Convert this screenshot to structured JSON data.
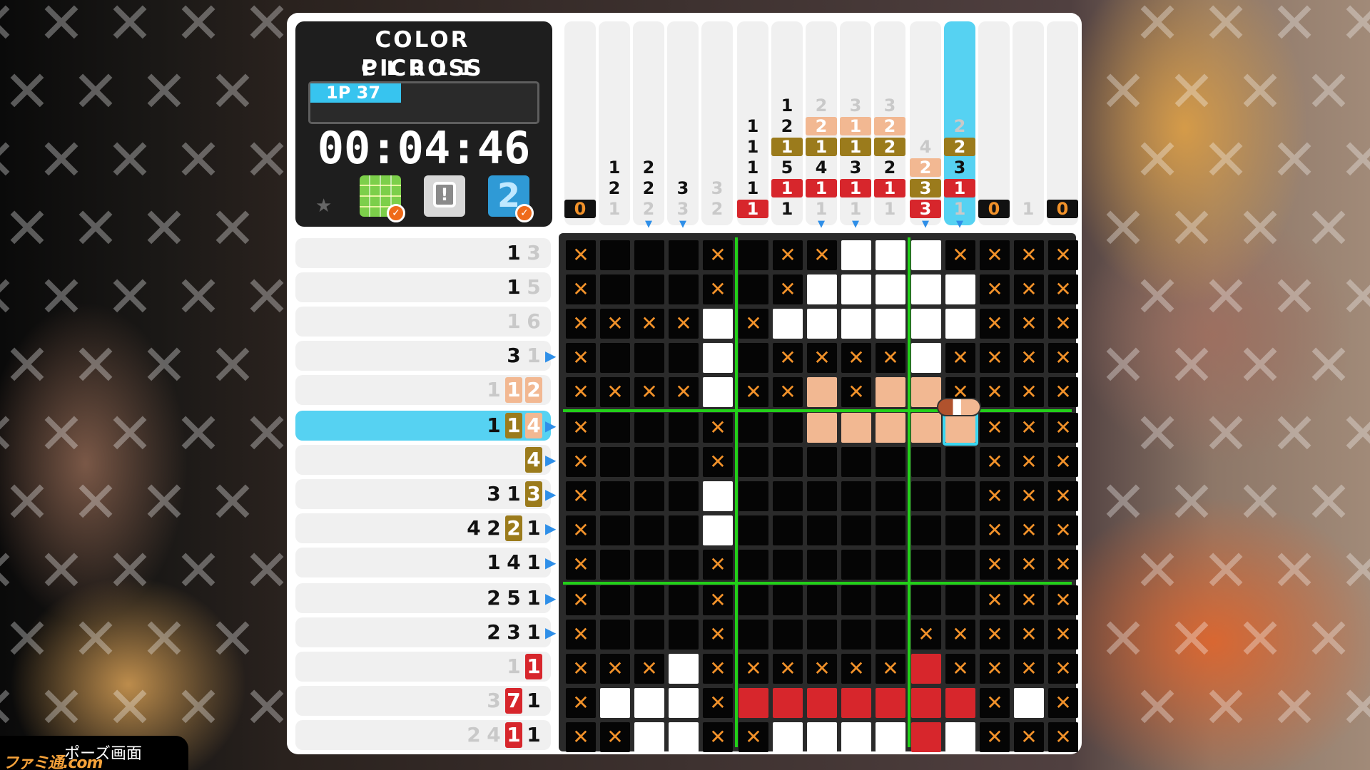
{
  "game": {
    "title": "COLOR PICROSS",
    "puzzle_code": "CL011",
    "player_label": "1P  37",
    "progress_fraction": 0.4,
    "timer": "00:04:46",
    "hints": [
      {
        "icon": "grid-hint-icon",
        "glyph": "",
        "used": true
      },
      {
        "icon": "exclamation-hint-icon",
        "glyph": "!",
        "used": false
      },
      {
        "icon": "number-2-hint-icon",
        "glyph": "2",
        "used": true
      }
    ],
    "footer_label": "ポーズ画面",
    "watermark": "ファミ通.com"
  },
  "colors": {
    "black": "#050505",
    "white": "#ffffff",
    "peach": "#f2b892",
    "olive": "#9b7b1c",
    "red": "#d7262c",
    "cross": "#f2922a",
    "highlight": "#56d2f2",
    "grid_line": "#22d019"
  },
  "grid_size": 15,
  "highlight_column": 11,
  "highlight_row": 5,
  "cursor": {
    "row": 5,
    "col": 11
  },
  "column_clues": [
    [
      {
        "n": "0",
        "c": "k"
      }
    ],
    [
      {
        "n": "1",
        "c": "t"
      },
      {
        "n": "2",
        "c": "t"
      },
      {
        "n": "1",
        "c": "g"
      }
    ],
    [
      {
        "n": "2",
        "c": "t"
      },
      {
        "n": "2",
        "c": "t"
      },
      {
        "n": "2",
        "c": "g"
      }
    ],
    [
      {
        "n": "3",
        "c": "t"
      },
      {
        "n": "3",
        "c": "g"
      }
    ],
    [
      {
        "n": "3",
        "c": "g"
      },
      {
        "n": "2",
        "c": "g"
      }
    ],
    [
      {
        "n": "1",
        "c": "t"
      },
      {
        "n": "1",
        "c": "t"
      },
      {
        "n": "1",
        "c": "t"
      },
      {
        "n": "1",
        "c": "t"
      },
      {
        "n": "1",
        "c": "r"
      }
    ],
    [
      {
        "n": "1",
        "c": "t"
      },
      {
        "n": "2",
        "c": "t"
      },
      {
        "n": "1",
        "c": "o"
      },
      {
        "n": "5",
        "c": "t"
      },
      {
        "n": "1",
        "c": "r"
      },
      {
        "n": "1",
        "c": "t"
      }
    ],
    [
      {
        "n": "2",
        "c": "g"
      },
      {
        "n": "2",
        "c": "p"
      },
      {
        "n": "1",
        "c": "o"
      },
      {
        "n": "4",
        "c": "t"
      },
      {
        "n": "1",
        "c": "r"
      },
      {
        "n": "1",
        "c": "g"
      }
    ],
    [
      {
        "n": "3",
        "c": "g"
      },
      {
        "n": "1",
        "c": "p"
      },
      {
        "n": "1",
        "c": "o"
      },
      {
        "n": "3",
        "c": "t"
      },
      {
        "n": "1",
        "c": "r"
      },
      {
        "n": "1",
        "c": "g"
      }
    ],
    [
      {
        "n": "3",
        "c": "g"
      },
      {
        "n": "2",
        "c": "p"
      },
      {
        "n": "2",
        "c": "o"
      },
      {
        "n": "2",
        "c": "t"
      },
      {
        "n": "1",
        "c": "r"
      },
      {
        "n": "1",
        "c": "g"
      }
    ],
    [
      {
        "n": "4",
        "c": "g"
      },
      {
        "n": "2",
        "c": "p"
      },
      {
        "n": "3",
        "c": "o"
      },
      {
        "n": "3",
        "c": "r"
      }
    ],
    [
      {
        "n": "2",
        "c": "g"
      },
      {
        "n": "2",
        "c": "o"
      },
      {
        "n": "3",
        "c": "t"
      },
      {
        "n": "1",
        "c": "r"
      },
      {
        "n": "1",
        "c": "g"
      }
    ],
    [
      {
        "n": "0",
        "c": "k"
      }
    ],
    [
      {
        "n": "1",
        "c": "g"
      }
    ],
    [
      {
        "n": "0",
        "c": "k"
      }
    ]
  ],
  "column_markers": [
    false,
    false,
    true,
    true,
    false,
    false,
    false,
    true,
    true,
    false,
    true,
    true,
    false,
    false,
    false
  ],
  "row_clues": [
    [
      {
        "n": "1",
        "c": "t"
      },
      {
        "n": "3",
        "c": "g"
      }
    ],
    [
      {
        "n": "1",
        "c": "t"
      },
      {
        "n": "5",
        "c": "g"
      }
    ],
    [
      {
        "n": "1",
        "c": "g"
      },
      {
        "n": "6",
        "c": "g"
      }
    ],
    [
      {
        "n": "3",
        "c": "t"
      },
      {
        "n": "1",
        "c": "g"
      }
    ],
    [
      {
        "n": "1",
        "c": "g"
      },
      {
        "n": "1",
        "c": "p"
      },
      {
        "n": "2",
        "c": "p"
      }
    ],
    [
      {
        "n": "1",
        "c": "t"
      },
      {
        "n": "1",
        "c": "o"
      },
      {
        "n": "4",
        "c": "p"
      }
    ],
    [
      {
        "n": "4",
        "c": "o"
      }
    ],
    [
      {
        "n": "3",
        "c": "t"
      },
      {
        "n": "1",
        "c": "t"
      },
      {
        "n": "3",
        "c": "o"
      }
    ],
    [
      {
        "n": "4",
        "c": "t"
      },
      {
        "n": "2",
        "c": "t"
      },
      {
        "n": "2",
        "c": "o"
      },
      {
        "n": "1",
        "c": "t"
      }
    ],
    [
      {
        "n": "1",
        "c": "t"
      },
      {
        "n": "4",
        "c": "t"
      },
      {
        "n": "1",
        "c": "t"
      }
    ],
    [
      {
        "n": "2",
        "c": "t"
      },
      {
        "n": "5",
        "c": "t"
      },
      {
        "n": "1",
        "c": "t"
      }
    ],
    [
      {
        "n": "2",
        "c": "t"
      },
      {
        "n": "3",
        "c": "t"
      },
      {
        "n": "1",
        "c": "t"
      }
    ],
    [
      {
        "n": "1",
        "c": "g"
      },
      {
        "n": "1",
        "c": "r"
      }
    ],
    [
      {
        "n": "3",
        "c": "g"
      },
      {
        "n": "7",
        "c": "r"
      },
      {
        "n": "1",
        "c": "t"
      }
    ],
    [
      {
        "n": "2",
        "c": "g"
      },
      {
        "n": "4",
        "c": "g"
      },
      {
        "n": "1",
        "c": "r"
      },
      {
        "n": "1",
        "c": "t"
      }
    ]
  ],
  "row_markers": [
    false,
    false,
    false,
    true,
    false,
    true,
    true,
    true,
    true,
    true,
    true,
    true,
    false,
    false,
    false
  ],
  "board": [
    "XkkkXkXXwwwXXXX",
    "XkkkXkXwwwwwXXX",
    "XXXXwXwwwwwwXXX",
    "XkkkwkXXXXwXXXX",
    "XXXXwXXpXppXXXX",
    "XkkkXkkpppppXXX",
    "XkkkXkkkkkkkXXX",
    "XkkkwkkkkkkkXXX",
    "XkkkwkkkkkkkXXX",
    "XkkkXkkkkkkkXXX",
    "XkkkXkkkkkkkXXX",
    "XkkkXkkkkkXXXXX",
    "XXXwXXXXXXrXXXX",
    "XwwwXrrrrrrrXwX",
    "XXwwXXwwwwrwXXX"
  ]
}
